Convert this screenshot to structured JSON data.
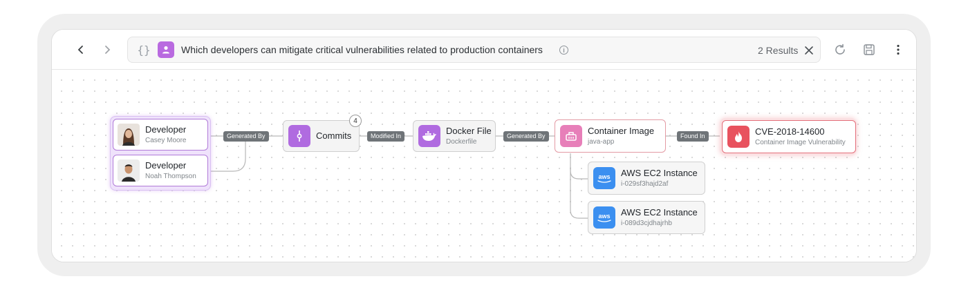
{
  "toolbar": {
    "query": "Which developers can mitigate critical vulnerabilities related to production containers",
    "results": "2 Results",
    "braces": "{}"
  },
  "graph": {
    "developers": [
      {
        "title": "Developer",
        "subtitle": "Casey Moore"
      },
      {
        "title": "Developer",
        "subtitle": "Noah Thompson"
      }
    ],
    "commits": {
      "title": "Commits",
      "count": "4"
    },
    "dockerfile": {
      "title": "Docker File",
      "subtitle": "Dockerfile"
    },
    "container": {
      "title": "Container Image",
      "subtitle": "java-app"
    },
    "cve": {
      "title": "CVE-2018-14600",
      "subtitle": "Container Image Vulnerability"
    },
    "instances": [
      {
        "title": "AWS EC2 Instance",
        "subtitle": "i-029sf3hajd2af",
        "badge": "aws"
      },
      {
        "title": "AWS EC2 Instance",
        "subtitle": "i-089d3cjdhajrhb",
        "badge": "aws"
      }
    ],
    "edges": {
      "generated_by_1": "Generated By",
      "modified_in": "Modified In",
      "generated_by_2": "Generated By",
      "found_in": "Found In"
    }
  },
  "colors": {
    "developer_accent": "#b07ad8",
    "commits_icon": "#b06be0",
    "docker_icon": "#b06be0",
    "container_icon": "#e77fb9",
    "cve_icon": "#e8525e",
    "aws_icon": "#3b8ff0"
  },
  "icons": [
    "chevron-left-icon",
    "chevron-right-icon",
    "braces-icon",
    "user-icon",
    "info-icon",
    "close-icon",
    "refresh-icon",
    "save-icon",
    "more-vertical-icon",
    "commit-icon",
    "docker-icon",
    "container-box-icon",
    "flame-icon",
    "aws-icon"
  ]
}
